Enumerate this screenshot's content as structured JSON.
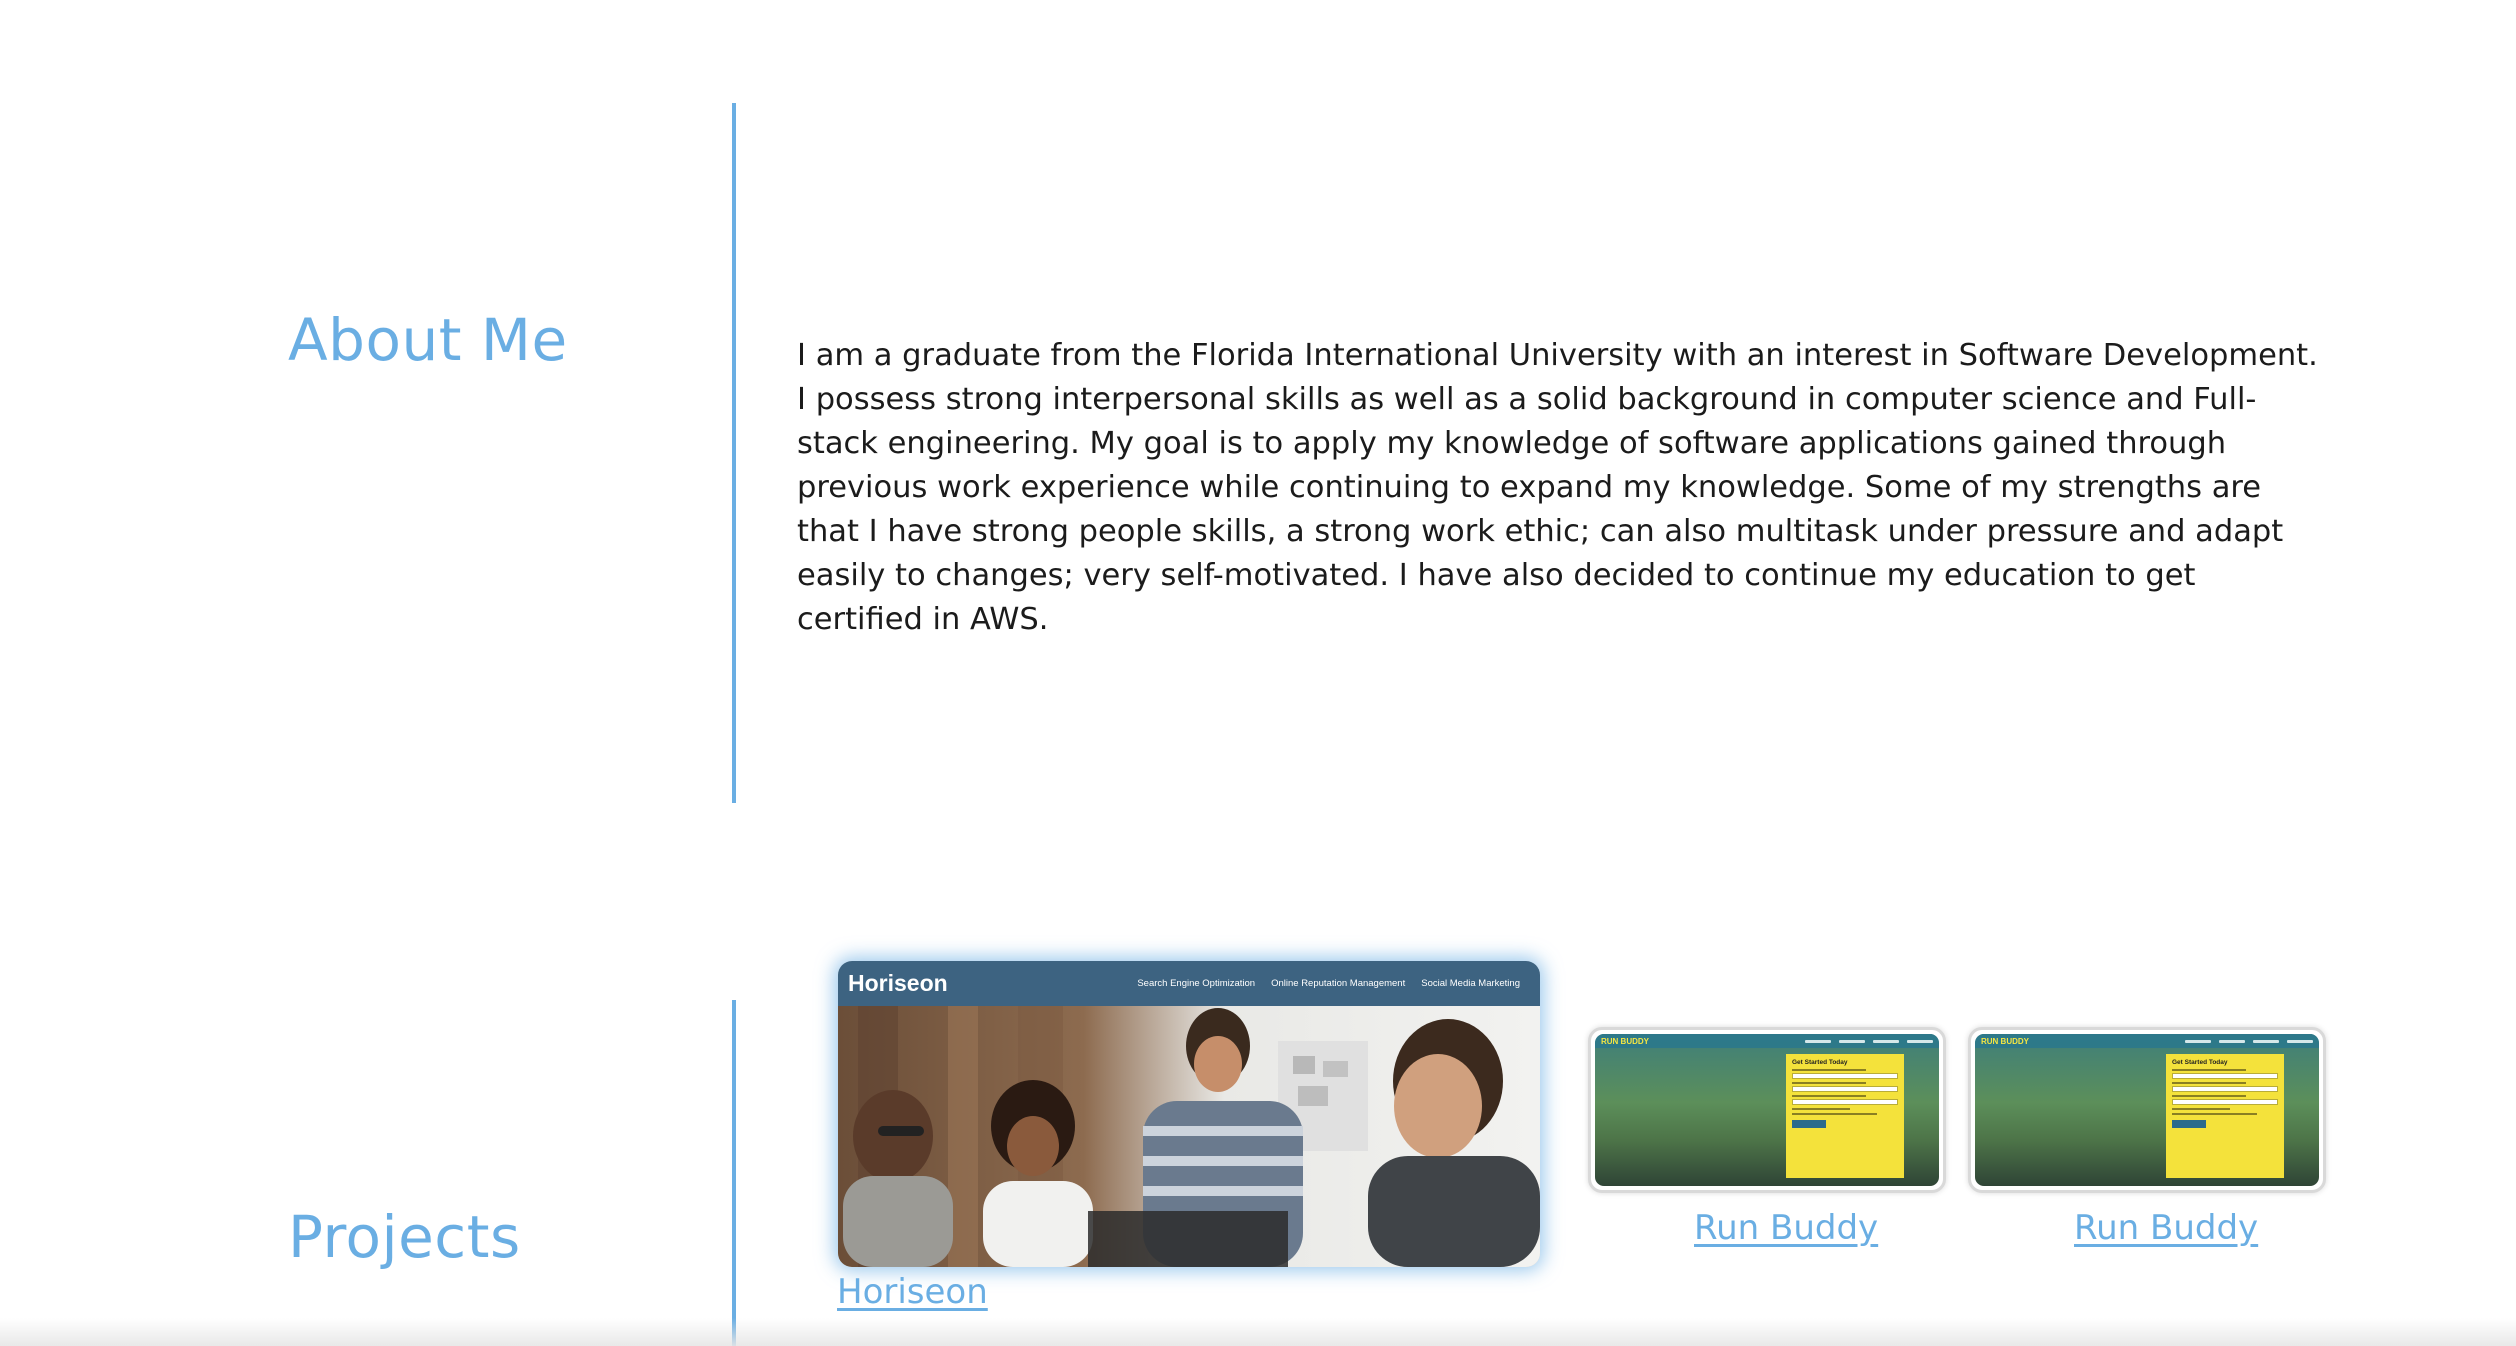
{
  "about": {
    "heading": "About Me",
    "text": "I am a graduate from the Florida International University with an interest in Software Development. I possess strong interpersonal skills as well as a solid background in computer science and Full-stack engineering. My goal is to apply my knowledge of software applications gained through previous work experience while continuing to expand my knowledge. Some of my strengths are that I have strong people skills, a strong work ethic; can also multitask under pressure and adapt easily to changes; very self-motivated. I have also decided to continue my education to get certified in AWS."
  },
  "projects": {
    "heading": "Projects",
    "items": [
      {
        "link_label": "Horiseon",
        "screenshot": {
          "logo": "Horiseon",
          "nav": [
            "Search Engine Optimization",
            "Online Reputation Management",
            "Social Media Marketing"
          ]
        }
      },
      {
        "link_label": "Run Buddy",
        "screenshot": {
          "logo": "RUN BUDDY",
          "form_title": "Get Started Today"
        }
      },
      {
        "link_label": "Run Buddy",
        "screenshot": {
          "logo": "RUN BUDDY",
          "form_title": "Get Started Today"
        }
      }
    ]
  },
  "colors": {
    "accent": "#6aaee3",
    "text": "#1b1b1b",
    "background": "#ffffff"
  }
}
